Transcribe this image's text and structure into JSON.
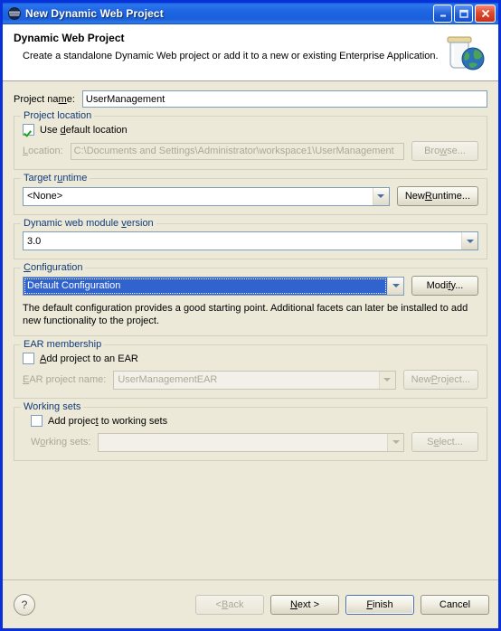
{
  "window": {
    "title": "New Dynamic Web Project",
    "icon": "globe-icon",
    "minimize_label": "_",
    "maximize_label": "❐",
    "close_label": "✕",
    "frame_color": "#0831d9",
    "titlebar_color": "#1e66e2",
    "body_color": "#ece9d8"
  },
  "header": {
    "title": "Dynamic Web Project",
    "subtitle": "Create a standalone Dynamic Web project or add it to a new or existing Enterprise Application.",
    "icon": "jar-globe-icon"
  },
  "form": {
    "project_name": {
      "label_pre": "Project na",
      "label_mnemonic": "m",
      "label_post": "e:",
      "value": "UserManagement"
    },
    "project_location": {
      "group_label": "Project location",
      "use_default": {
        "label_pre": "Use ",
        "label_mnemonic": "d",
        "label_post": "efault location",
        "checked": true
      },
      "location": {
        "label_pre": "",
        "label_mnemonic": "L",
        "label_post": "ocation:",
        "value": "C:\\Documents and Settings\\Administrator\\workspace1\\UserManagement",
        "enabled": false
      },
      "browse_button": {
        "label_pre": "Bro",
        "label_mnemonic": "w",
        "label_post": "se...",
        "enabled": false
      }
    },
    "target_runtime": {
      "group_label_pre": "Target r",
      "group_label_mnemonic": "u",
      "group_label_post": "ntime",
      "value": "<None>",
      "new_runtime_button": {
        "label_pre": "New ",
        "label_mnemonic": "R",
        "label_post": "untime...",
        "enabled": true
      }
    },
    "module_version": {
      "group_label_pre": "Dynamic web module ",
      "group_label_mnemonic": "v",
      "group_label_post": "ersion",
      "value": "3.0"
    },
    "configuration": {
      "group_label_pre": "",
      "group_label_mnemonic": "C",
      "group_label_post": "onfiguration",
      "value": "Default Configuration",
      "selected": true,
      "modify_button": {
        "label_pre": "Modi",
        "label_mnemonic": "f",
        "label_post": "y...",
        "enabled": true
      },
      "description": "The default configuration provides a good starting point. Additional facets can later be installed to add new functionality to the project."
    },
    "ear_membership": {
      "group_label": "EAR membership",
      "add_to_ear": {
        "label_pre": "",
        "label_mnemonic": "A",
        "label_post": "dd project to an EAR",
        "checked": false
      },
      "ear_project_name": {
        "label_pre": "",
        "label_mnemonic": "E",
        "label_post": "AR project name:",
        "value": "UserManagementEAR",
        "enabled": false
      },
      "new_project_button": {
        "label_pre": "New ",
        "label_mnemonic": "P",
        "label_post": "roject...",
        "enabled": false
      }
    },
    "working_sets": {
      "group_label": "Working sets",
      "add_to_working_sets": {
        "label_pre": "Add projec",
        "label_mnemonic": "t",
        "label_post": " to working sets",
        "checked": false
      },
      "working_sets_field": {
        "label_pre": "W",
        "label_mnemonic": "o",
        "label_post": "rking sets:",
        "value": "",
        "enabled": false
      },
      "select_button": {
        "label_pre": "S",
        "label_mnemonic": "e",
        "label_post": "lect...",
        "enabled": false
      }
    }
  },
  "footer": {
    "help_label": "?",
    "back_button": {
      "label_pre": "< ",
      "label_mnemonic": "B",
      "label_post": "ack",
      "enabled": false
    },
    "next_button": {
      "label_pre": "",
      "label_mnemonic": "N",
      "label_post": "ext >",
      "enabled": true
    },
    "finish_button": {
      "label_pre": "",
      "label_mnemonic": "F",
      "label_post": "inish",
      "enabled": true,
      "is_default": true
    },
    "cancel_button": {
      "label_pre": "Cancel",
      "label_mnemonic": "",
      "label_post": "",
      "enabled": true
    }
  },
  "colors": {
    "group_label": "#113a77",
    "selection": "#3163ce",
    "disabled_text": "#aca899"
  }
}
